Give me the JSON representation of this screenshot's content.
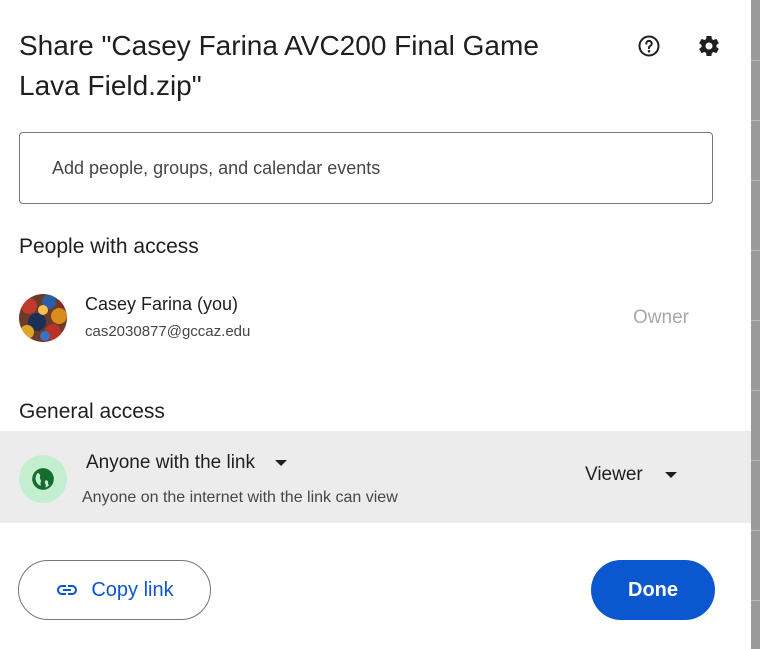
{
  "dialog": {
    "title": "Share \"Casey Farina AVC200 Final Game Lava Field.zip\"",
    "help_icon": "help-icon",
    "settings_icon": "gear-icon"
  },
  "add_people": {
    "placeholder": "Add people, groups, and calendar events",
    "value": ""
  },
  "people_access": {
    "heading": "People with access",
    "people": [
      {
        "name": "Casey Farina (you)",
        "email": "cas2030877@gccaz.edu",
        "role": "Owner"
      }
    ]
  },
  "general_access": {
    "heading": "General access",
    "icon": "globe-icon",
    "selected": "Anyone with the link",
    "description": "Anyone on the internet with the link can view",
    "role": "Viewer"
  },
  "footer": {
    "copy_link_label": "Copy link",
    "copy_link_icon": "link-icon",
    "done_label": "Done"
  },
  "colors": {
    "primary": "#0b57d0",
    "globe_bg": "#c4eed0",
    "row_highlight": "#ececec"
  }
}
